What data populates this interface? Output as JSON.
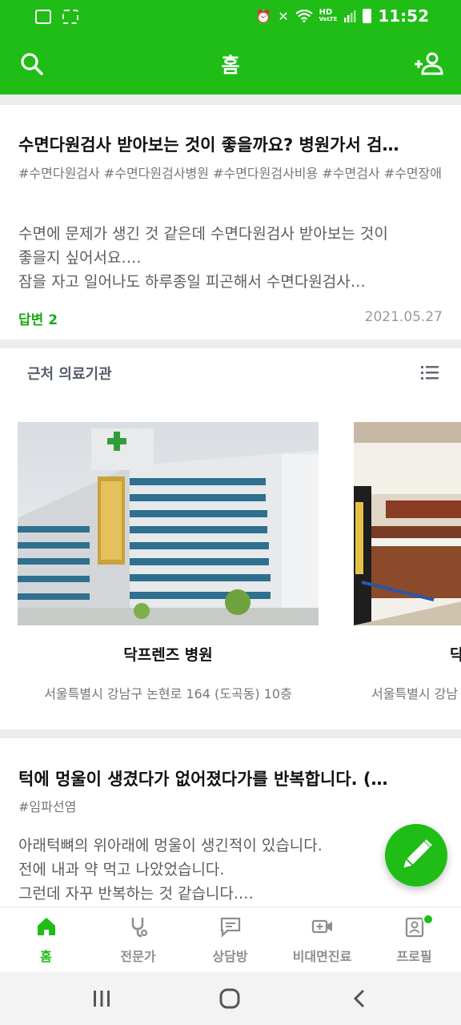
{
  "statusbar": {
    "time": "11:52",
    "hd_label": "HD",
    "voice_label": "VoLTE"
  },
  "appbar": {
    "title": "홈",
    "left_icon": "search-icon",
    "right_icon": "add-user-icon"
  },
  "question1": {
    "title": "수면다원검사 받아보는 것이 좋을까요? 병원가서 검…",
    "tags": "#수면다원검사 #수면다원검사병원 #수면다원검사비용 #수면검사 #수면장애",
    "body_lines": [
      "수면에 문제가 생긴 것 같은데 수면다원검사 받아보는 것이",
      "좋을지 싶어서요….",
      "잠을 자고 일어나도 하루종일 피곤해서 수면다원검사…"
    ],
    "answer": "답변 2",
    "date": "2021.05.27"
  },
  "nearby": {
    "title": "근처 의료기관",
    "list_icon": "list-icon",
    "hospitals": [
      {
        "name": "닥프렌즈 병원",
        "address": "서울특별시 강남구 논현로 164 (도곡동) 10층"
      },
      {
        "name": "닥",
        "address": "서울특별시 강남"
      }
    ]
  },
  "question2": {
    "title": "턱에 멍울이 생겼다가 없어졌다가를 반복합니다. (…",
    "tags": "#임파선염",
    "body_lines": [
      "아래턱뼈의 위아래에 멍울이 생긴적이 있습니다.",
      "전에 내과 약 먹고 나았었습니다.",
      "그런데 자꾸 반복하는 것 같습니다.…"
    ]
  },
  "fab": {
    "icon": "pencil-icon"
  },
  "bottom_nav": [
    {
      "label": "홈",
      "icon": "home-icon",
      "active": true
    },
    {
      "label": "전문가",
      "icon": "stethoscope-icon"
    },
    {
      "label": "상담방",
      "icon": "chat-icon"
    },
    {
      "label": "비대면진료",
      "icon": "video-call-icon"
    },
    {
      "label": "프로필",
      "icon": "profile-icon"
    }
  ],
  "colors": {
    "brand": "#1fbd16",
    "answer_green": "#1faa16"
  }
}
